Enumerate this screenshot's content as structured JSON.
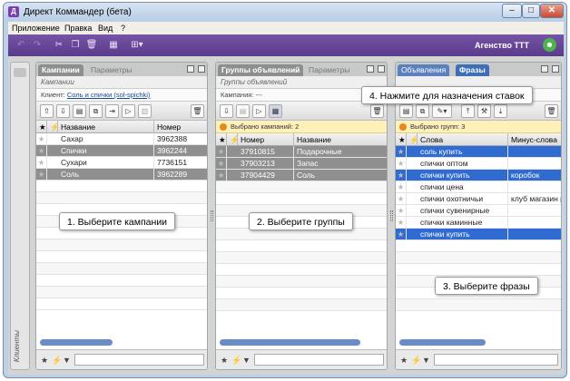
{
  "window": {
    "title": "Директ Коммандер (бета)",
    "app_icon": "app-icon",
    "minimize": "–",
    "maximize": "□",
    "close": "✕"
  },
  "menu": {
    "items": [
      "Приложение",
      "Правка",
      "Вид",
      "?"
    ]
  },
  "toolbar": {
    "agency": "Агенство ТТТ",
    "icons": [
      "undo-icon",
      "redo-icon",
      "cut-icon",
      "copy-icon",
      "delete-icon",
      "grid-icon",
      "layout-icon"
    ]
  },
  "sidebar": {
    "label": "Клиенты"
  },
  "campaigns": {
    "tabs": [
      "Кампании",
      "Параметры"
    ],
    "subheader": "Кампании",
    "client_label": "Клиент:",
    "client_value": "Соль и спички (sol-spichki)",
    "columns": [
      "Название",
      "Номер"
    ],
    "rows": [
      {
        "name": "Сахар",
        "number": "3962388",
        "state": "normal"
      },
      {
        "name": "Спички",
        "number": "3962244",
        "state": "selected"
      },
      {
        "name": "Сухари",
        "number": "7736151",
        "state": "normal"
      },
      {
        "name": "Соль",
        "number": "3962289",
        "state": "selected"
      }
    ],
    "callout": "1. Выберите кампании"
  },
  "groups": {
    "tabs": [
      "Группы объявлений",
      "Параметры"
    ],
    "subheader": "Группы объявлений",
    "campaign_label": "Кампания: ---",
    "banner": "Выбрано кампаний: 2",
    "columns": [
      "Номер",
      "Название"
    ],
    "rows": [
      {
        "number": "37910815",
        "name": "Подарочные"
      },
      {
        "number": "37903213",
        "name": "Запас"
      },
      {
        "number": "37904429",
        "name": "Соль"
      }
    ],
    "callout": "2. Выберите группы"
  },
  "phrases": {
    "tabs": [
      "Объявления",
      "Фразы"
    ],
    "banner": "Выбрано групп: 3",
    "columns": [
      "Слова",
      "Минус-слова"
    ],
    "rows": [
      {
        "words": "соль купить",
        "minus": "",
        "state": "hl"
      },
      {
        "words": "спички оптом",
        "minus": "",
        "state": "normal"
      },
      {
        "words": "спички купить",
        "minus": "коробок",
        "state": "hl"
      },
      {
        "words": "спички цена",
        "minus": "",
        "state": "normal"
      },
      {
        "words": "спички охотничьи",
        "minus": "клуб магазин р",
        "state": "normal"
      },
      {
        "words": "спички сувенирные",
        "minus": "",
        "state": "normal"
      },
      {
        "words": "спички каминные",
        "minus": "",
        "state": "normal"
      },
      {
        "words": "спички купить",
        "minus": "",
        "state": "hl"
      }
    ],
    "callout_bids": "4. Нажмите для назначения ставок",
    "callout_phrases": "3. Выберите фразы"
  },
  "filter": {
    "star": "★",
    "bolt": "⚡",
    "funnel": "▼"
  }
}
